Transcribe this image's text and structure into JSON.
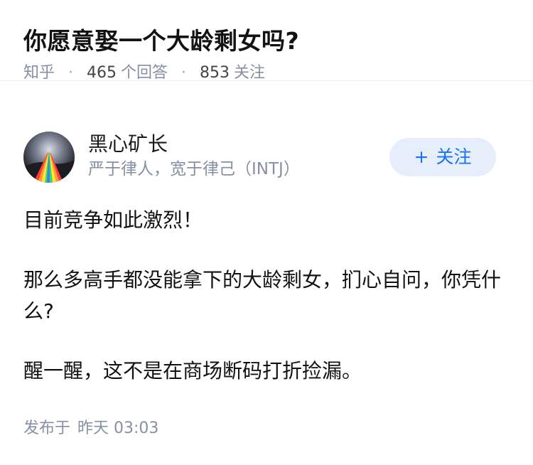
{
  "question": {
    "title": "你愿意娶一个大龄剩女吗?",
    "source": "知乎",
    "answer_count": "465",
    "answer_label": "个回答",
    "follower_count": "853",
    "follower_label": "关注",
    "separator": "·"
  },
  "author": {
    "name": "黑心矿长",
    "bio": "严于律人，宽于律己（INTJ）",
    "avatar_icon": "rainbow-road-avatar",
    "follow_plus": "+",
    "follow_label": "关注"
  },
  "answer": {
    "paragraphs": [
      "目前竞争如此激烈！",
      "那么多高手都没能拿下的大龄剩女，扪心自问，你凭什么?",
      "醒一醒，这不是在商场断码打折捡漏。"
    ]
  },
  "footer": {
    "published_label": "发布于",
    "published_time": "昨天 03:03"
  },
  "colors": {
    "meta_gray": "#8590a6",
    "accent_blue": "#1772f6",
    "button_bg": "#e5eefa",
    "text": "#121212"
  }
}
